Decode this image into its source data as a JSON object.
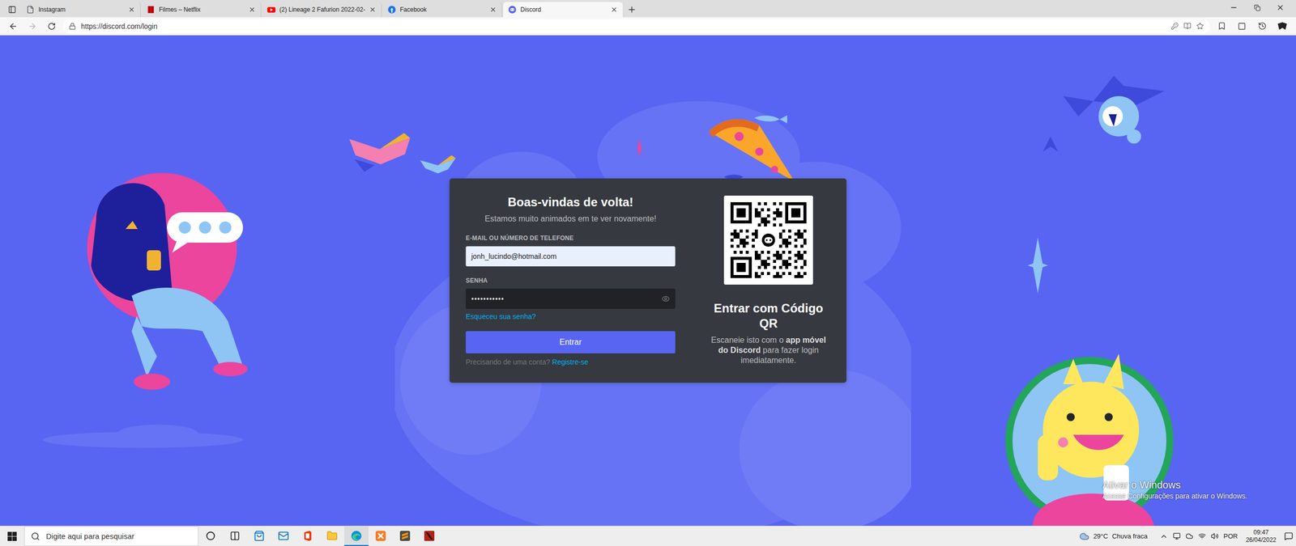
{
  "browser": {
    "tabs": [
      {
        "label": "Instagram",
        "kind": "page",
        "selected": false
      },
      {
        "label": "Filmes – Netflix",
        "kind": "netflix",
        "selected": false
      },
      {
        "label": "(2) Lineage 2 Fafurion 2022-02-",
        "kind": "youtube",
        "selected": false
      },
      {
        "label": "Facebook",
        "kind": "facebook",
        "selected": false
      },
      {
        "label": "Discord",
        "kind": "discord",
        "selected": true
      }
    ],
    "nav_buttons": [
      {
        "kind": "back",
        "disabled": false
      },
      {
        "kind": "forward",
        "disabled": true
      },
      {
        "kind": "reload",
        "disabled": false
      }
    ],
    "url": "https://discord.com/login"
  },
  "login": {
    "title": "Boas-vindas de volta!",
    "subtitle": "Estamos muito animados em te ver novamente!",
    "email_label": "E-MAIL OU NÚMERO DE TELEFONE",
    "email_value": "jonh_lucindo@hotmail.com",
    "password_label": "SENHA",
    "password_mask": "•••••••••••",
    "forgot": "Esqueceu sua senha?",
    "submit": "Entrar",
    "register_prompt": "Precisando de uma conta?",
    "register_link": "Registre-se"
  },
  "qr": {
    "title": "Entrar com Código QR",
    "text_before": "Escaneie isto com o ",
    "text_bold": "app móvel do Discord",
    "text_after": " para fazer login imediatamente."
  },
  "watermark": {
    "title": "Ativar o Windows",
    "subtitle": "Acesse Configurações para ativar o Windows."
  },
  "taskbar": {
    "search_placeholder": "Digite aqui para pesquisar",
    "apps": [
      {
        "kind": "cortana",
        "selected": false
      },
      {
        "kind": "taskview",
        "selected": false
      },
      {
        "kind": "store",
        "selected": false
      },
      {
        "kind": "mail",
        "selected": false
      },
      {
        "kind": "office",
        "selected": false
      },
      {
        "kind": "explorer",
        "selected": false
      },
      {
        "kind": "edge",
        "selected": true
      },
      {
        "kind": "xampp",
        "selected": false
      },
      {
        "kind": "sublime",
        "selected": false
      },
      {
        "kind": "dota",
        "selected": false
      }
    ],
    "weather": {
      "temp": "29°C",
      "condition": "Chuva fraca"
    },
    "language": "POR",
    "time": "09:47",
    "date": "26/04/2022"
  }
}
